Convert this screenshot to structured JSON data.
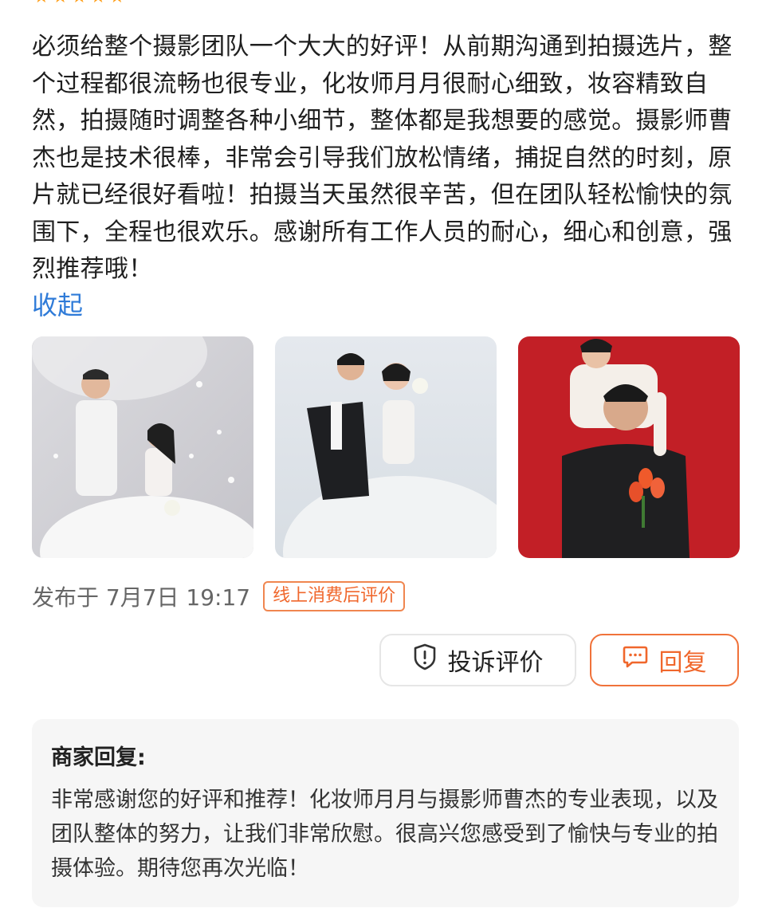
{
  "review": {
    "stars": [
      "★",
      "★",
      "★",
      "★",
      "★"
    ],
    "text": "必须给整个摄影团队一个大大的好评！从前期沟通到拍摄选片，整个过程都很流畅也很专业，化妆师月月很耐心细致，妆容精致自然，拍摄随时调整各种小细节，整体都是我想要的感觉。摄影师曹杰也是技术很棒，非常会引导我们放松情绪，捕捉自然的时刻，原片就已经很好看啦！拍摄当天虽然很辛苦，但在团队轻松愉快的氛围下，全程也很欢乐。感谢所有工作人员的耐心，细心和创意，强烈推荐哦！",
    "collapse_label": "收起"
  },
  "photos": [
    {
      "icon": "wedding-photo-white-suit"
    },
    {
      "icon": "wedding-photo-black-suit"
    },
    {
      "icon": "couple-photo-red-background"
    }
  ],
  "meta": {
    "published": "发布于 7月7日 19:17",
    "badge": "线上消费后评价"
  },
  "actions": {
    "report_label": "投诉评价",
    "reply_label": "回复"
  },
  "merchant_reply": {
    "title": "商家回复:",
    "text": "非常感谢您的好评和推荐！化妆师月月与摄影师曹杰的专业表现，以及团队整体的努力，让我们非常欣慰。很高兴您感受到了愉快与专业的拍摄体验。期待您再次光临！"
  },
  "colors": {
    "accent": "#f0672c",
    "link": "#2f7bd8",
    "star": "#ff9f1a"
  }
}
